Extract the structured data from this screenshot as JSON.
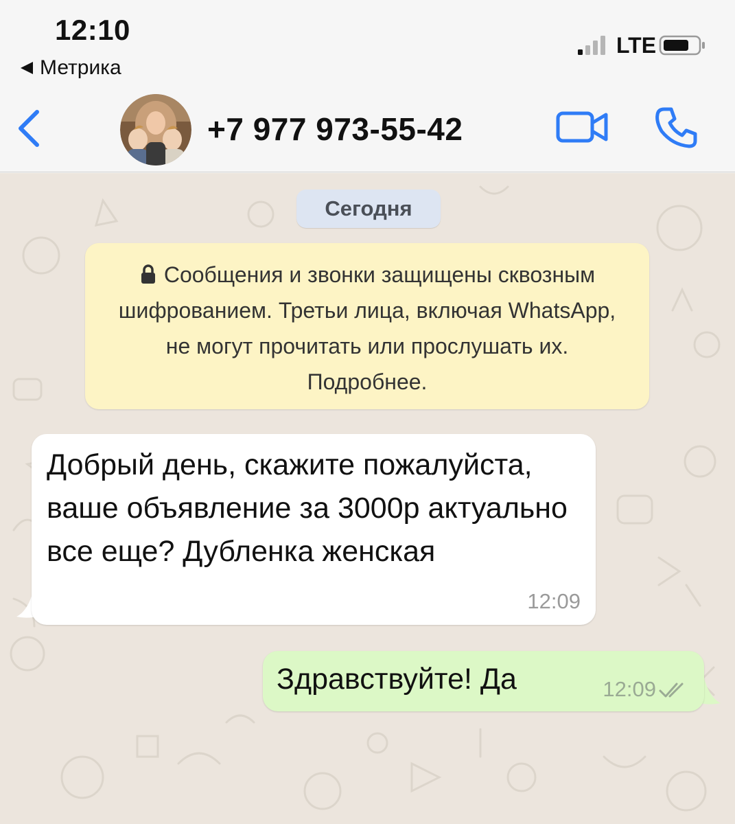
{
  "status_bar": {
    "time": "12:10",
    "back_app": "Метрика",
    "network": "LTE"
  },
  "header": {
    "contact_name": "+7 977 973-55-42"
  },
  "chat": {
    "date_label": "Сегодня",
    "encryption_notice": "Сообщения и звонки защищены сквозным шифрованием. Третьи лица, включая WhatsApp, не могут прочитать или прослушать их. Подробнее.",
    "messages": [
      {
        "direction": "incoming",
        "text": "Добрый день, скажите пожалуйста, ваше объявление за 3000р актуально все еще? Дубленка женская",
        "time": "12:09"
      },
      {
        "direction": "outgoing",
        "text": "Здравствуйте! Да",
        "time": "12:09",
        "status": "read"
      }
    ]
  },
  "colors": {
    "accent_blue": "#2f7cf6",
    "incoming_bubble": "#ffffff",
    "outgoing_bubble": "#dcf8c6",
    "system_notice": "#fdf4c5",
    "chat_background": "#ece5dd"
  }
}
